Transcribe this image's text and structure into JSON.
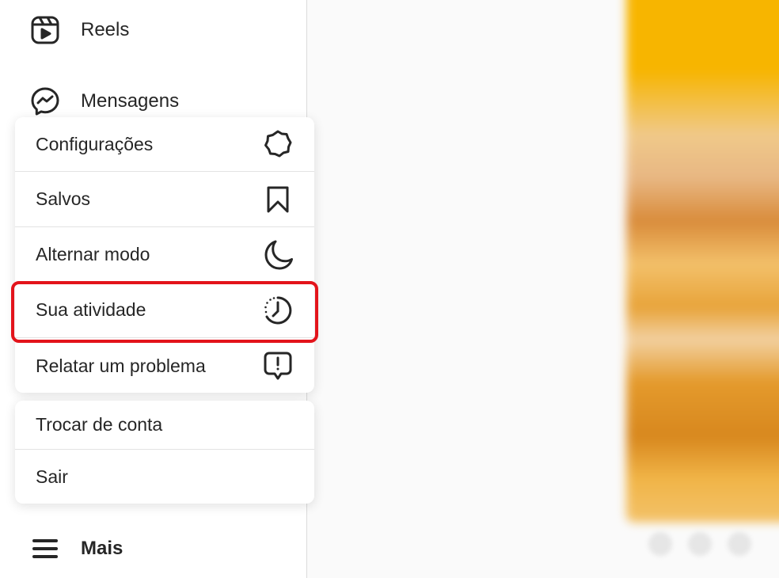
{
  "sidebar": {
    "reels_label": "Reels",
    "messages_label": "Mensagens",
    "more_label": "Mais"
  },
  "menu": {
    "items": [
      {
        "label": "Configurações",
        "icon": "settings-icon"
      },
      {
        "label": "Salvos",
        "icon": "bookmark-icon"
      },
      {
        "label": "Alternar modo",
        "icon": "moon-icon"
      },
      {
        "label": "Sua atividade",
        "icon": "activity-icon"
      },
      {
        "label": "Relatar um problema",
        "icon": "report-icon"
      }
    ],
    "secondary": [
      {
        "label": "Trocar de conta"
      },
      {
        "label": "Sair"
      }
    ]
  },
  "colors": {
    "highlight": "#e3141b",
    "text": "#262626"
  }
}
